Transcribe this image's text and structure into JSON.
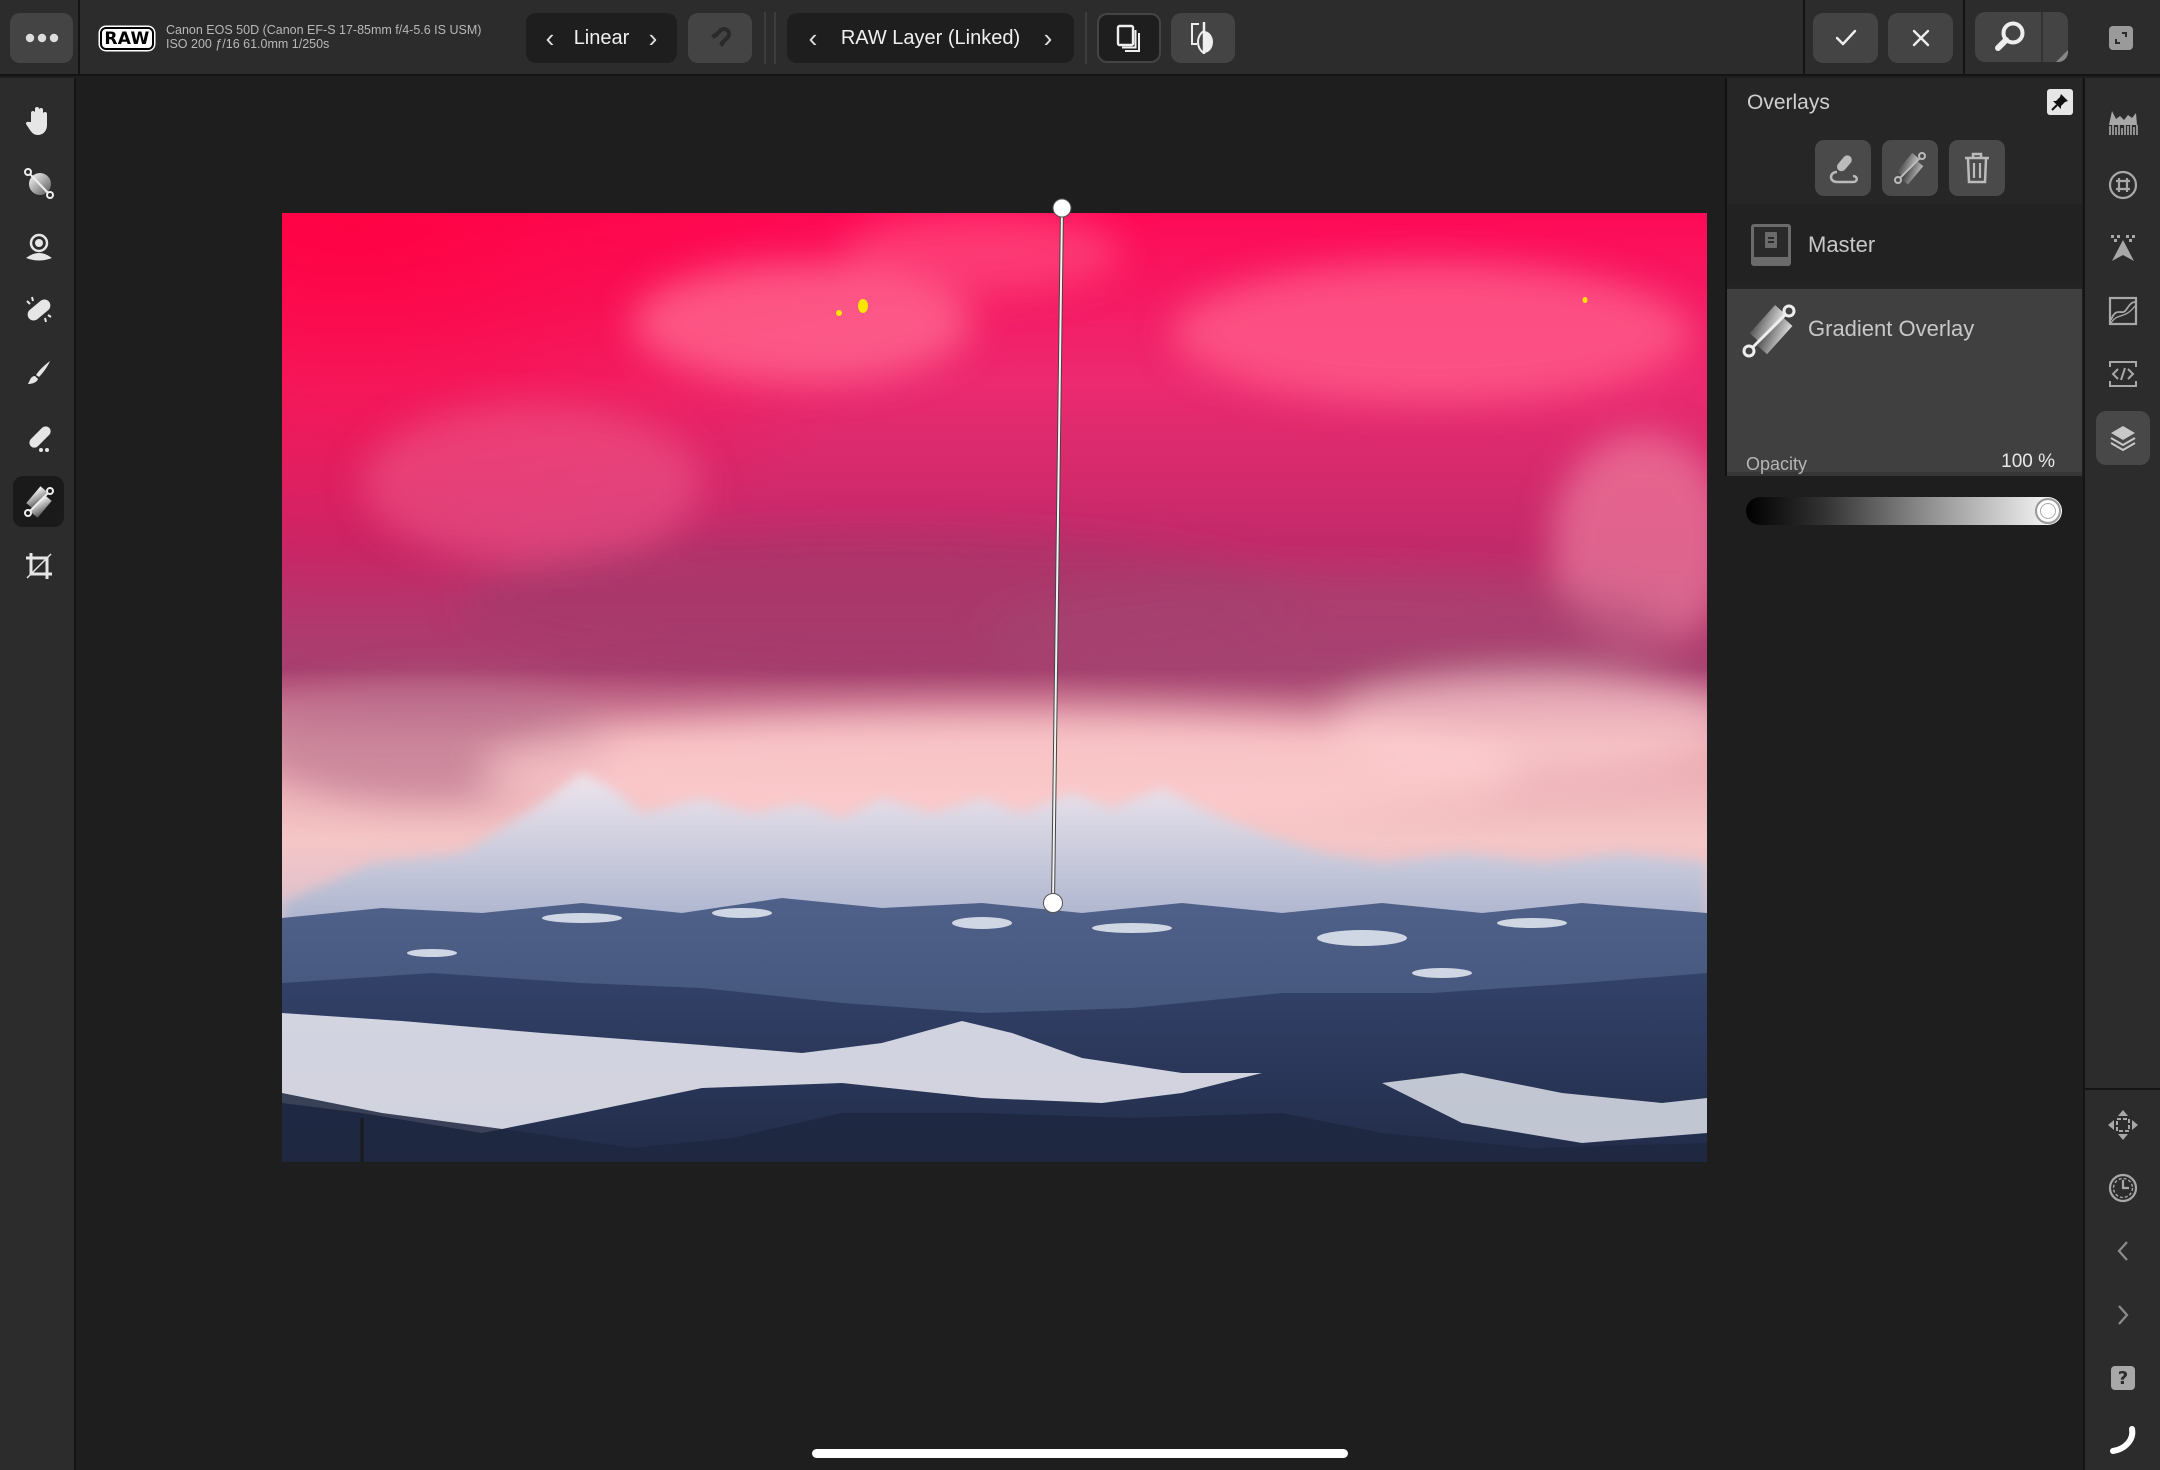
{
  "topbar": {
    "more_button_label": "More options",
    "raw_badge": "RAW",
    "camera_line1": "Canon EOS 50D (Canon EF-S 17-85mm f/4-5.6 IS USM)",
    "camera_line2": "ISO 200 ƒ/16 61.0mm 1/250s",
    "gradient_type": "Linear",
    "layer_selector": "RAW Layer (Linked)",
    "icons": {
      "more": "more-dots-icon",
      "magnet": "magnet-snap-icon",
      "stack": "layer-stack-icon",
      "compare": "split-compare-icon",
      "apply": "checkmark-icon",
      "cancel": "close-icon",
      "zoom": "magnifier-icon",
      "fullscreen": "expand-icon"
    }
  },
  "left_tools": [
    {
      "name": "hand-tool",
      "icon": "hand-icon",
      "active": false
    },
    {
      "name": "radial-gradient-tool",
      "icon": "radial-gradient-icon",
      "active": false
    },
    {
      "name": "red-eye-tool",
      "icon": "redeye-icon",
      "active": false
    },
    {
      "name": "healing-tool",
      "icon": "bandage-icon",
      "active": false
    },
    {
      "name": "brush-tool",
      "icon": "brush-icon",
      "active": false
    },
    {
      "name": "erase-tool",
      "icon": "eraser-icon",
      "active": false
    },
    {
      "name": "gradient-overlay-tool",
      "icon": "linear-gradient-icon",
      "active": true
    },
    {
      "name": "crop-tool",
      "icon": "crop-icon",
      "active": false
    }
  ],
  "overlays_panel": {
    "title": "Overlays",
    "pin_icon": "pin-icon",
    "actions": [
      {
        "name": "brush-overlay",
        "icon": "paint-overlay-icon"
      },
      {
        "name": "gradient-overlay",
        "icon": "gradient-overlay-icon"
      },
      {
        "name": "delete-overlay",
        "icon": "trash-icon"
      }
    ],
    "layers": [
      {
        "name": "Master",
        "icon": "master-layer-icon",
        "selected": false
      },
      {
        "name": "Gradient Overlay",
        "icon": "gradient-overlay-icon",
        "selected": true
      }
    ],
    "opacity": {
      "label": "Opacity",
      "value_text": "100 %",
      "value": 100,
      "min": 0,
      "max": 100
    }
  },
  "right_tools": [
    {
      "name": "histogram",
      "icon": "histogram-icon",
      "active": false
    },
    {
      "name": "grid",
      "icon": "grid-icon",
      "active": false
    },
    {
      "name": "clipping",
      "icon": "clipping-icon",
      "active": false
    },
    {
      "name": "curves",
      "icon": "curves-icon",
      "active": false
    },
    {
      "name": "scope",
      "icon": "code-scope-icon",
      "active": false
    },
    {
      "name": "layers",
      "icon": "layers-icon",
      "active": true
    }
  ],
  "right_bottom_tools": [
    {
      "name": "navigator",
      "icon": "move-arrows-icon"
    },
    {
      "name": "history",
      "icon": "history-clock-icon"
    },
    {
      "name": "previous",
      "icon": "chevron-left-icon"
    },
    {
      "name": "next",
      "icon": "chevron-right-icon"
    },
    {
      "name": "help",
      "icon": "help-icon"
    },
    {
      "name": "context",
      "icon": "curve-handle-icon"
    }
  ],
  "canvas": {
    "photo_description": "Mountain landscape with pink-magenta gradient overlay on sky",
    "overlay_color": "#ff0a5a",
    "gradient_handles": 2
  }
}
